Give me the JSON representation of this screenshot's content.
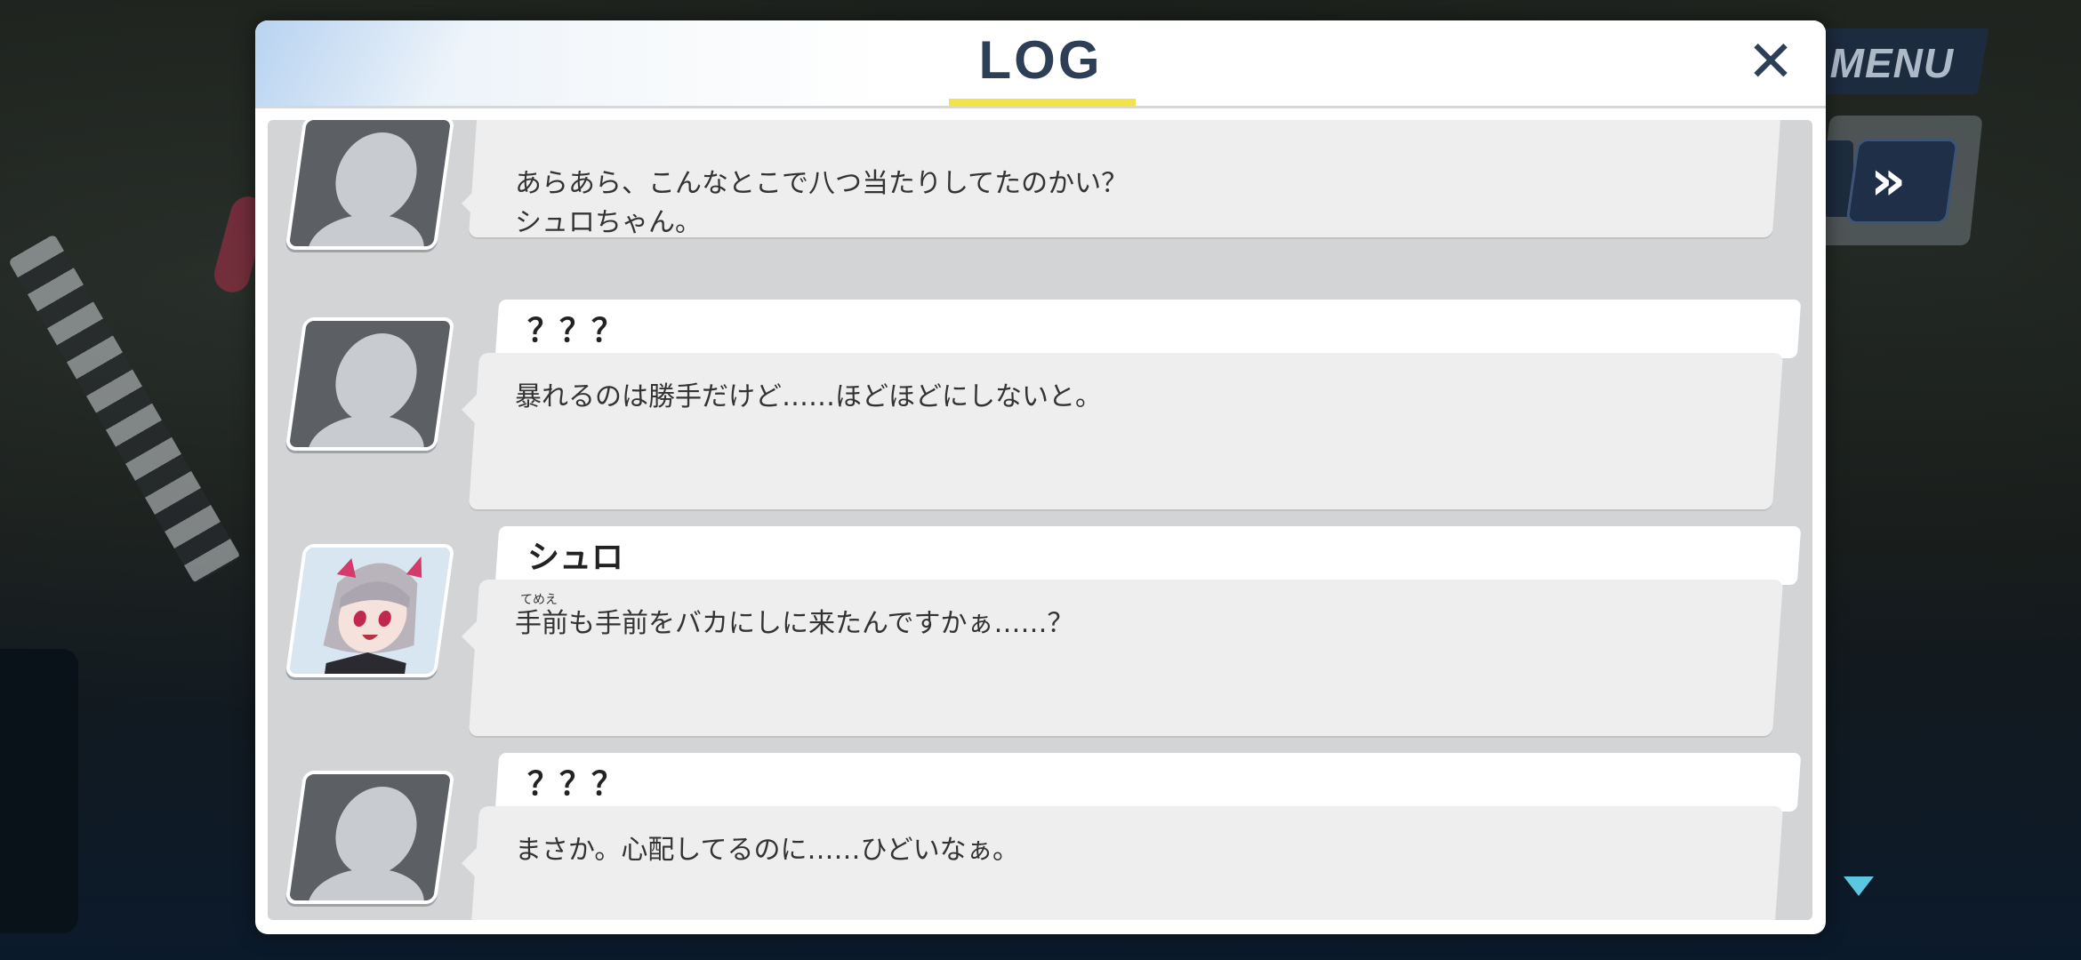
{
  "hud": {
    "menu_label": "MENU",
    "fast_forward_icon": "fast-forward-icon",
    "scroll_indicator_icon": "triangle-down-icon"
  },
  "log": {
    "title": "LOG",
    "close_icon": "close-icon",
    "entries": [
      {
        "speaker": "",
        "avatar": "silhouette",
        "lines": [
          "あらあら、こんなとこで八つ当たりしてたのかい？",
          "シュロちゃん。"
        ]
      },
      {
        "speaker": "？？？",
        "avatar": "silhouette",
        "lines": [
          "暴れるのは勝手だけど……ほどほどにしないと。"
        ]
      },
      {
        "speaker": "シュロ",
        "avatar": "character-portrait",
        "ruby": "てめえ",
        "lines": [
          "手前も手前をバカにしに来たんですかぁ……？"
        ]
      },
      {
        "speaker": "？？？",
        "avatar": "silhouette",
        "lines": [
          "まさか。心配してるのに……ひどいなぁ。"
        ]
      }
    ]
  },
  "colors": {
    "title": "#2d3e57",
    "title_underline": "#f2e34a",
    "bubble": "#eeeeee",
    "log_background": "#d2d4d6"
  }
}
